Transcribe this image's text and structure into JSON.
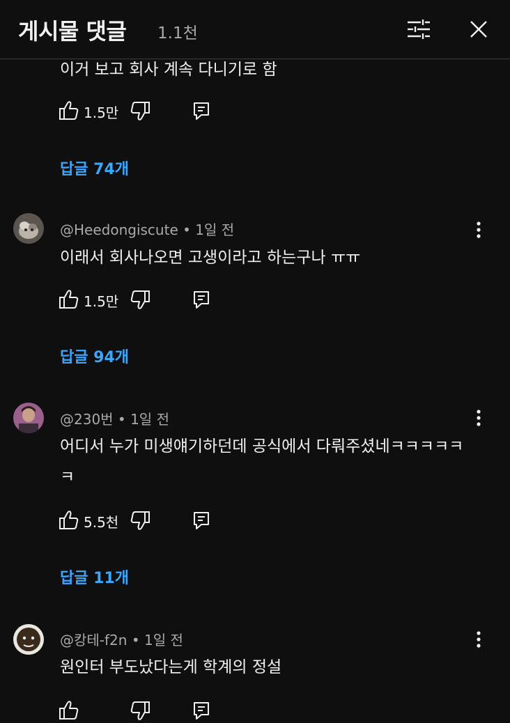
{
  "header": {
    "title": "게시물 댓글",
    "count": "1.1천"
  },
  "comments": [
    {
      "text": "이거 보고 회사 계속 다니기로 함",
      "likes": "1.5만",
      "replies": "답글 74개"
    },
    {
      "meta": "@Heedongiscute • 1일 전",
      "text": "이래서 회사나오면 고생이라고 하는구나 ㅠㅠ",
      "likes": "1.5만",
      "replies": "답글 94개"
    },
    {
      "meta": "@230번 • 1일 전",
      "text": "어디서 누가 미생얘기하던데 공식에서 다뤄주셨네ㅋㅋㅋㅋㅋㅋ",
      "likes": "5.5천",
      "replies": "답글 11개"
    },
    {
      "meta": "@캉테-f2n • 1일 전",
      "text": "원인터 부도났다는게 학계의 정설"
    }
  ],
  "icons": {
    "filter": "filter-icon",
    "close": "close-icon",
    "more": "more-vert-icon",
    "like": "thumb-up-icon",
    "dislike": "thumb-down-icon",
    "reply": "reply-icon"
  },
  "colors": {
    "background": "#0f0f0f",
    "text": "#f1f1f1",
    "secondary": "#aaaaaa",
    "link": "#3ea6ff"
  }
}
